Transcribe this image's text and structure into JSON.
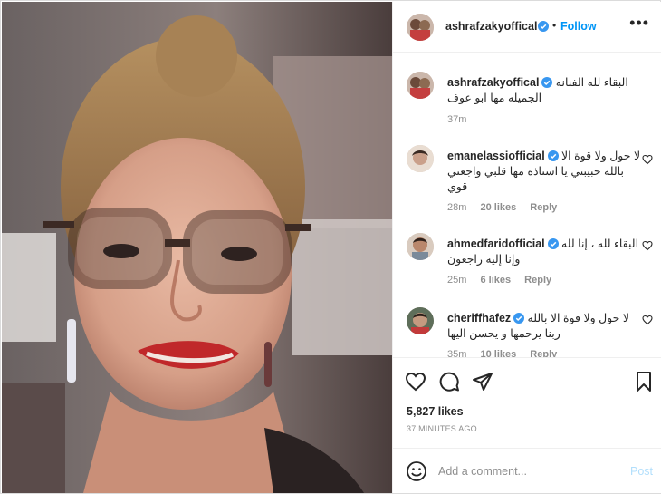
{
  "post": {
    "username": "ashrafzakyoffical",
    "follow_label": "Follow",
    "separator": "•",
    "more_label": "•••",
    "likes": "5,827 likes",
    "time_ago": "37 MINUTES AGO"
  },
  "caption": {
    "username": "ashrafzakyoffical",
    "text": "البقاء لله الفنانه الجميله مها ابو عوف",
    "time": "37m"
  },
  "comments": [
    {
      "username": "emanelassiofficial",
      "text": "لا حول ولا قوة الا بالله حبيبتي يا استاذه مها قلبي واجعني قوي",
      "time": "28m",
      "likes": "20 likes",
      "reply": "Reply"
    },
    {
      "username": "ahmedfaridofficial",
      "text": "البقاء لله ، إنا لله وإنا إليه راجعون",
      "time": "25m",
      "likes": "6 likes",
      "reply": "Reply"
    },
    {
      "username": "cheriffhafez",
      "text": "لا حول ولا قوة الا بالله ربنا يرحمها و يحسن اليها",
      "time": "35m",
      "likes": "10 likes",
      "reply": "Reply"
    }
  ],
  "add_comment": {
    "placeholder": "Add a comment...",
    "post_label": "Post"
  },
  "colors": {
    "accent": "#0095f6",
    "verified": "#3897f0",
    "muted": "#8e8e8e",
    "post_disabled": "#b2dffc"
  },
  "icons": [
    "heart-icon",
    "comment-icon",
    "share-icon",
    "bookmark-icon",
    "emoji-icon",
    "verified-icon",
    "more-options-icon"
  ]
}
